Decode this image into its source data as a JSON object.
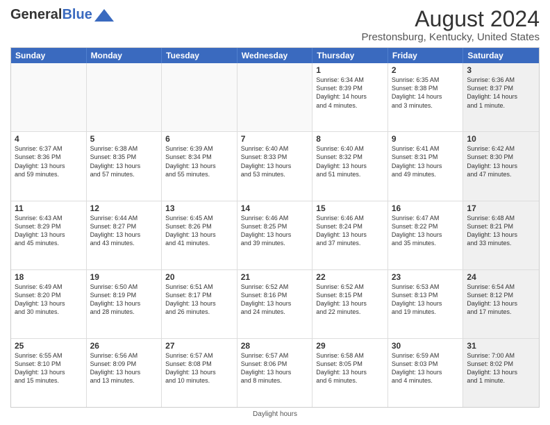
{
  "logo": {
    "general": "General",
    "blue": "Blue"
  },
  "title": "August 2024",
  "subtitle": "Prestonsburg, Kentucky, United States",
  "days_header": [
    "Sunday",
    "Monday",
    "Tuesday",
    "Wednesday",
    "Thursday",
    "Friday",
    "Saturday"
  ],
  "footer": "Daylight hours",
  "weeks": [
    [
      {
        "day": "",
        "info": "",
        "empty": true
      },
      {
        "day": "",
        "info": "",
        "empty": true
      },
      {
        "day": "",
        "info": "",
        "empty": true
      },
      {
        "day": "",
        "info": "",
        "empty": true
      },
      {
        "day": "1",
        "info": "Sunrise: 6:34 AM\nSunset: 8:39 PM\nDaylight: 14 hours\nand 4 minutes."
      },
      {
        "day": "2",
        "info": "Sunrise: 6:35 AM\nSunset: 8:38 PM\nDaylight: 14 hours\nand 3 minutes."
      },
      {
        "day": "3",
        "info": "Sunrise: 6:36 AM\nSunset: 8:37 PM\nDaylight: 14 hours\nand 1 minute.",
        "shaded": true
      }
    ],
    [
      {
        "day": "4",
        "info": "Sunrise: 6:37 AM\nSunset: 8:36 PM\nDaylight: 13 hours\nand 59 minutes."
      },
      {
        "day": "5",
        "info": "Sunrise: 6:38 AM\nSunset: 8:35 PM\nDaylight: 13 hours\nand 57 minutes."
      },
      {
        "day": "6",
        "info": "Sunrise: 6:39 AM\nSunset: 8:34 PM\nDaylight: 13 hours\nand 55 minutes."
      },
      {
        "day": "7",
        "info": "Sunrise: 6:40 AM\nSunset: 8:33 PM\nDaylight: 13 hours\nand 53 minutes."
      },
      {
        "day": "8",
        "info": "Sunrise: 6:40 AM\nSunset: 8:32 PM\nDaylight: 13 hours\nand 51 minutes."
      },
      {
        "day": "9",
        "info": "Sunrise: 6:41 AM\nSunset: 8:31 PM\nDaylight: 13 hours\nand 49 minutes."
      },
      {
        "day": "10",
        "info": "Sunrise: 6:42 AM\nSunset: 8:30 PM\nDaylight: 13 hours\nand 47 minutes.",
        "shaded": true
      }
    ],
    [
      {
        "day": "11",
        "info": "Sunrise: 6:43 AM\nSunset: 8:29 PM\nDaylight: 13 hours\nand 45 minutes."
      },
      {
        "day": "12",
        "info": "Sunrise: 6:44 AM\nSunset: 8:27 PM\nDaylight: 13 hours\nand 43 minutes."
      },
      {
        "day": "13",
        "info": "Sunrise: 6:45 AM\nSunset: 8:26 PM\nDaylight: 13 hours\nand 41 minutes."
      },
      {
        "day": "14",
        "info": "Sunrise: 6:46 AM\nSunset: 8:25 PM\nDaylight: 13 hours\nand 39 minutes."
      },
      {
        "day": "15",
        "info": "Sunrise: 6:46 AM\nSunset: 8:24 PM\nDaylight: 13 hours\nand 37 minutes."
      },
      {
        "day": "16",
        "info": "Sunrise: 6:47 AM\nSunset: 8:22 PM\nDaylight: 13 hours\nand 35 minutes."
      },
      {
        "day": "17",
        "info": "Sunrise: 6:48 AM\nSunset: 8:21 PM\nDaylight: 13 hours\nand 33 minutes.",
        "shaded": true
      }
    ],
    [
      {
        "day": "18",
        "info": "Sunrise: 6:49 AM\nSunset: 8:20 PM\nDaylight: 13 hours\nand 30 minutes."
      },
      {
        "day": "19",
        "info": "Sunrise: 6:50 AM\nSunset: 8:19 PM\nDaylight: 13 hours\nand 28 minutes."
      },
      {
        "day": "20",
        "info": "Sunrise: 6:51 AM\nSunset: 8:17 PM\nDaylight: 13 hours\nand 26 minutes."
      },
      {
        "day": "21",
        "info": "Sunrise: 6:52 AM\nSunset: 8:16 PM\nDaylight: 13 hours\nand 24 minutes."
      },
      {
        "day": "22",
        "info": "Sunrise: 6:52 AM\nSunset: 8:15 PM\nDaylight: 13 hours\nand 22 minutes."
      },
      {
        "day": "23",
        "info": "Sunrise: 6:53 AM\nSunset: 8:13 PM\nDaylight: 13 hours\nand 19 minutes."
      },
      {
        "day": "24",
        "info": "Sunrise: 6:54 AM\nSunset: 8:12 PM\nDaylight: 13 hours\nand 17 minutes.",
        "shaded": true
      }
    ],
    [
      {
        "day": "25",
        "info": "Sunrise: 6:55 AM\nSunset: 8:10 PM\nDaylight: 13 hours\nand 15 minutes."
      },
      {
        "day": "26",
        "info": "Sunrise: 6:56 AM\nSunset: 8:09 PM\nDaylight: 13 hours\nand 13 minutes."
      },
      {
        "day": "27",
        "info": "Sunrise: 6:57 AM\nSunset: 8:08 PM\nDaylight: 13 hours\nand 10 minutes."
      },
      {
        "day": "28",
        "info": "Sunrise: 6:57 AM\nSunset: 8:06 PM\nDaylight: 13 hours\nand 8 minutes."
      },
      {
        "day": "29",
        "info": "Sunrise: 6:58 AM\nSunset: 8:05 PM\nDaylight: 13 hours\nand 6 minutes."
      },
      {
        "day": "30",
        "info": "Sunrise: 6:59 AM\nSunset: 8:03 PM\nDaylight: 13 hours\nand 4 minutes."
      },
      {
        "day": "31",
        "info": "Sunrise: 7:00 AM\nSunset: 8:02 PM\nDaylight: 13 hours\nand 1 minute.",
        "shaded": true
      }
    ]
  ]
}
